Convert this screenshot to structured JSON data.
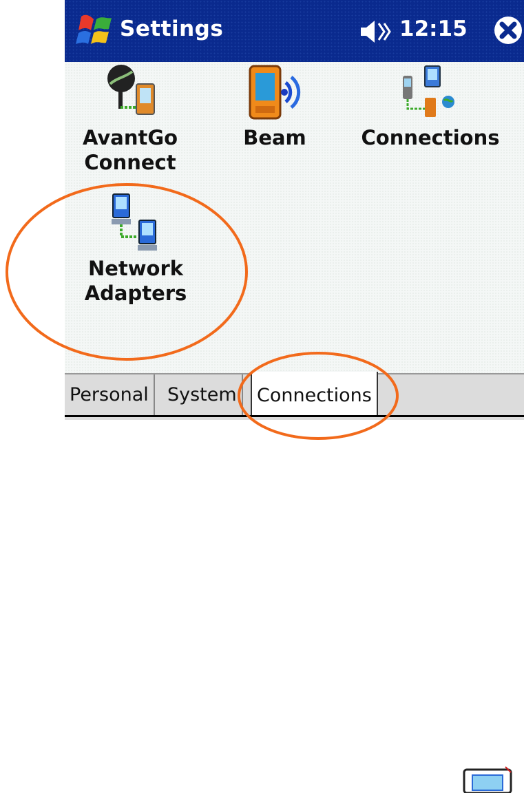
{
  "titlebar": {
    "title": "Settings",
    "time": "12:15",
    "start_icon": "windows-start-icon",
    "volume_icon": "speaker-icon",
    "close_icon": "close-icon"
  },
  "items": [
    {
      "label": "AvantGo\nConnect",
      "icon": "avantgo-connect-icon"
    },
    {
      "label": "Beam",
      "icon": "beam-icon"
    },
    {
      "label": "Connections",
      "icon": "connections-icon"
    },
    {
      "label": "Network\nAdapters",
      "icon": "network-adapters-icon"
    }
  ],
  "tabs": {
    "personal": "Personal",
    "system": "System",
    "connections": "Connections",
    "active": "Connections"
  },
  "sip_icon": "keyboard-icon",
  "colors": {
    "titlebar": "#0a2a8e",
    "annotation": "#f26a1b"
  }
}
